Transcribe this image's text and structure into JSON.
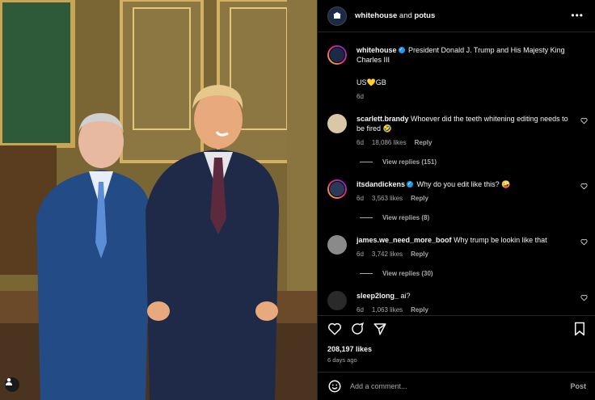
{
  "header": {
    "user1": "whitehouse",
    "and": " and ",
    "user2": "potus",
    "more_icon": "more-horizontal-icon"
  },
  "caption": {
    "username": "whitehouse",
    "text": "President Donald J. Trump and His Majesty King Charles III",
    "flags": "US💛GB",
    "time": "6d"
  },
  "comments": [
    {
      "username": "scarlett.brandy",
      "verified": false,
      "text": "Whoever did the teeth whitening editing needs to be fired 🤣",
      "time": "6d",
      "likes": "18,086 likes",
      "reply": "Reply",
      "view_replies": "View replies (151)"
    },
    {
      "username": "itsdandickens",
      "verified": true,
      "text": "Why do you edit like this? 🤪",
      "time": "6d",
      "likes": "3,563 likes",
      "reply": "Reply",
      "view_replies": "View replies (8)"
    },
    {
      "username": "james.we_need_more_boof",
      "verified": false,
      "text": "Why trump be lookin like that",
      "time": "6d",
      "likes": "3,742 likes",
      "reply": "Reply",
      "view_replies": "View replies (30)"
    },
    {
      "username": "sleep2long_",
      "verified": false,
      "text": "ai?",
      "time": "6d",
      "likes": "1,063 likes",
      "reply": "Reply"
    }
  ],
  "actions": {
    "likes": "208,197 likes",
    "time": "6 days ago"
  },
  "add_comment": {
    "placeholder": "Add a comment...",
    "post_label": "Post"
  },
  "colors": {
    "background": "#000000",
    "text": "#f5f5f5",
    "muted": "#a8a8a8",
    "verified": "#1d9bf0",
    "border": "#262626"
  }
}
